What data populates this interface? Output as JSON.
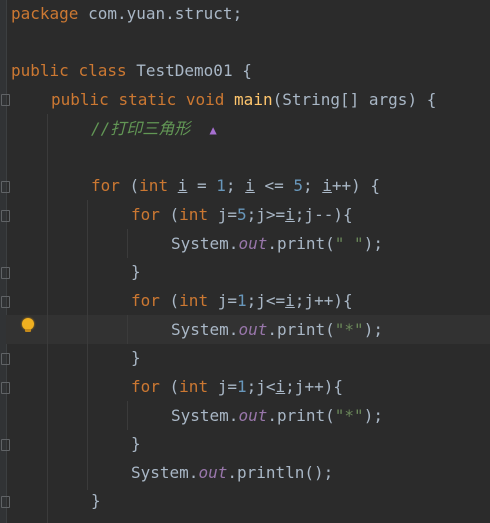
{
  "code": {
    "l1_kw": "package",
    "l1_rest": " com.yuan.struct;",
    "l3_kw1": "public",
    "l3_kw2": "class",
    "l3_rest": " TestDemo01 {",
    "l4_kw1": "public",
    "l4_kw2": "static",
    "l4_kw3": "void",
    "l4_fn": "main",
    "l4_rest": "(String[] args) {",
    "l5_comment": "//打印三角形",
    "l5_marker": "▲",
    "l7_for": "for",
    "l7_p1": " (",
    "l7_int": "int",
    "l7_i1": "i",
    "l7_p2": " = ",
    "l7_n1": "1",
    "l7_p3": "; ",
    "l7_i2": "i",
    "l7_p4": " <= ",
    "l7_n2": "5",
    "l7_p5": "; ",
    "l7_i3": "i",
    "l7_p6": "++) {",
    "l8_for": "for",
    "l8_p1": " (",
    "l8_int": "int",
    "l8_p2": " j=",
    "l8_n": "5",
    "l8_p3": ";j>=",
    "l8_i": "i",
    "l8_p4": ";j--){",
    "l9_a": "System.",
    "l9_out": "out",
    "l9_b": ".print(",
    "l9_str": "\" \"",
    "l9_c": ");",
    "l10": "}",
    "l11_for": "for",
    "l11_p1": " (",
    "l11_int": "int",
    "l11_p2": " j=",
    "l11_n": "1",
    "l11_p3": ";j<=",
    "l11_i": "i",
    "l11_p4": ";j++){",
    "l12_a": "System.",
    "l12_out": "out",
    "l12_b": ".print(",
    "l12_str": "\"*\"",
    "l12_c": ");",
    "l13": "}",
    "l14_for": "for",
    "l14_p1": " (",
    "l14_int": "int",
    "l14_p2": " j=",
    "l14_n": "1",
    "l14_p3": ";j<",
    "l14_i": "i",
    "l14_p4": ";j++){",
    "l15_a": "System.",
    "l15_out": "out",
    "l15_b": ".print(",
    "l15_str": "\"*\"",
    "l15_c": ");",
    "l16": "}",
    "l17_a": "System.",
    "l17_out": "out",
    "l17_b": ".println();",
    "l18": "}"
  },
  "icons": {
    "bulb": "lightbulb-icon",
    "fold": "fold-marker-icon"
  },
  "colors": {
    "background": "#2b2b2b",
    "keyword": "#cc7832",
    "function": "#ffc66d",
    "number": "#6897bb",
    "string": "#6a8759",
    "field": "#9876aa",
    "comment": "#629755",
    "text": "#a9b7c6"
  }
}
